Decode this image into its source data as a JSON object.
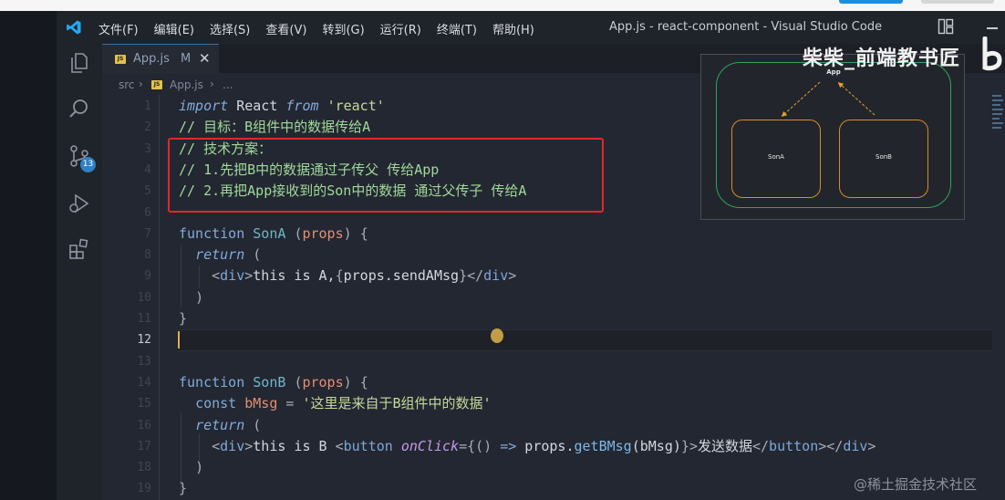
{
  "window": {
    "title": "App.js - react-component - Visual Studio Code",
    "menu": [
      "文件(F)",
      "编辑(E)",
      "选择(S)",
      "查看(V)",
      "转到(G)",
      "运行(R)",
      "终端(T)",
      "帮助(H)"
    ]
  },
  "activity": {
    "scm_badge": "13"
  },
  "tab": {
    "file_badge": "JS",
    "name": "App.js",
    "modified": "M"
  },
  "breadcrumb": {
    "folder": "src",
    "file": "App.js",
    "more": "..."
  },
  "editor": {
    "lines": [
      {
        "n": "1",
        "code": [
          [
            "kwi",
            "import"
          ],
          [
            "ident",
            " React "
          ],
          [
            "kwi",
            "from"
          ],
          [
            "ident",
            " "
          ],
          [
            "str",
            "'react'"
          ]
        ]
      },
      {
        "n": "2",
        "code": [
          [
            "cm",
            "// 目标：B组件中的数据传给A"
          ]
        ]
      },
      {
        "n": "3",
        "code": [
          [
            "cm",
            "// 技术方案："
          ]
        ]
      },
      {
        "n": "4",
        "code": [
          [
            "cm",
            "// 1.先把B中的数据通过子传父 传给App"
          ]
        ]
      },
      {
        "n": "5",
        "code": [
          [
            "cm",
            "// 2.再把App接收到的Son中的数据 通过父传子 传给A"
          ]
        ]
      },
      {
        "n": "6",
        "code": []
      },
      {
        "n": "7",
        "code": [
          [
            "kw",
            "function"
          ],
          [
            "ident",
            " "
          ],
          [
            "fn",
            "SonA"
          ],
          [
            "ident",
            " "
          ],
          [
            "punc",
            "("
          ],
          [
            "param",
            "props"
          ],
          [
            "punc",
            ")"
          ],
          [
            "ident",
            " "
          ],
          [
            "punc",
            "{"
          ]
        ]
      },
      {
        "n": "8",
        "code": [
          [
            "ident",
            "  "
          ],
          [
            "kwi",
            "return"
          ],
          [
            "ident",
            " "
          ],
          [
            "punc",
            "("
          ]
        ]
      },
      {
        "n": "9",
        "code": [
          [
            "ident",
            "    "
          ],
          [
            "punc",
            "<"
          ],
          [
            "tag",
            "div"
          ],
          [
            "punc",
            ">"
          ],
          [
            "ident",
            "this is A,"
          ],
          [
            "punc",
            "{"
          ],
          [
            "ident",
            "props.sendAMsg"
          ],
          [
            "punc",
            "}"
          ],
          [
            "punc",
            "</"
          ],
          [
            "tag",
            "div"
          ],
          [
            "punc",
            ">"
          ]
        ]
      },
      {
        "n": "10",
        "code": [
          [
            "ident",
            "  "
          ],
          [
            "punc",
            ")"
          ]
        ]
      },
      {
        "n": "11",
        "code": [
          [
            "punc",
            "}"
          ]
        ]
      },
      {
        "n": "12",
        "code": []
      },
      {
        "n": "13",
        "code": []
      },
      {
        "n": "14",
        "code": [
          [
            "kw",
            "function"
          ],
          [
            "ident",
            " "
          ],
          [
            "fn",
            "SonB"
          ],
          [
            "ident",
            " "
          ],
          [
            "punc",
            "("
          ],
          [
            "param",
            "props"
          ],
          [
            "punc",
            ")"
          ],
          [
            "ident",
            " "
          ],
          [
            "punc",
            "{"
          ]
        ]
      },
      {
        "n": "15",
        "code": [
          [
            "ident",
            "  "
          ],
          [
            "kw",
            "const"
          ],
          [
            "ident",
            " "
          ],
          [
            "param",
            "bMsg"
          ],
          [
            "ident",
            " "
          ],
          [
            "punc",
            "="
          ],
          [
            "ident",
            " "
          ],
          [
            "str",
            "'这里是来自于B组件中的数据'"
          ]
        ]
      },
      {
        "n": "16",
        "code": [
          [
            "ident",
            "  "
          ],
          [
            "kwi",
            "return"
          ],
          [
            "ident",
            " "
          ],
          [
            "punc",
            "("
          ]
        ]
      },
      {
        "n": "17",
        "code": [
          [
            "ident",
            "    "
          ],
          [
            "punc",
            "<"
          ],
          [
            "tag",
            "div"
          ],
          [
            "punc",
            ">"
          ],
          [
            "ident",
            "this is B "
          ],
          [
            "punc",
            "<"
          ],
          [
            "tag",
            "button"
          ],
          [
            "ident",
            " "
          ],
          [
            "attr",
            "onClick"
          ],
          [
            "punc",
            "={"
          ],
          [
            "punc",
            "()"
          ],
          [
            "ident",
            " "
          ],
          [
            "kw",
            "=>"
          ],
          [
            "ident",
            " props."
          ],
          [
            "method",
            "getBMsg"
          ],
          [
            "ident",
            "(bMsg)"
          ],
          [
            "punc",
            "}"
          ],
          [
            "punc",
            ">"
          ],
          [
            "ident",
            "发送数据"
          ],
          [
            "punc",
            "</"
          ],
          [
            "tag",
            "button"
          ],
          [
            "punc",
            "></"
          ],
          [
            "tag",
            "div"
          ],
          [
            "punc",
            ">"
          ]
        ]
      },
      {
        "n": "18",
        "code": [
          [
            "ident",
            "  "
          ],
          [
            "punc",
            ")"
          ]
        ]
      },
      {
        "n": "19",
        "code": [
          [
            "punc",
            "}"
          ]
        ]
      }
    ],
    "active_line": "12"
  },
  "thumbnail": {
    "app": "App",
    "son_a": "SonA",
    "son_b": "SonB"
  },
  "watermark": {
    "top": "柴柴_前端教书匠",
    "bottom": "@稀土掘金技术社区"
  },
  "colors": {
    "accent_red": "#e2262c",
    "green_frame": "#2ea65a",
    "orange_frame": "#d88b2a",
    "vscode_blue": "#23a9f2"
  }
}
